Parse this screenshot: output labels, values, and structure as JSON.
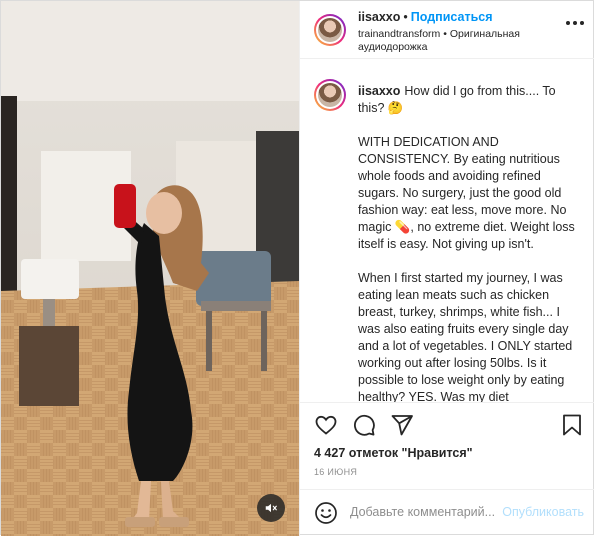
{
  "header": {
    "username": "iisaxxo",
    "separator": "•",
    "follow_label": "Подписаться",
    "audio_source": "trainandtransform",
    "audio_separator": "•",
    "audio_label": "Оригинальная аудиодорожка"
  },
  "caption": {
    "username": "iisaxxo",
    "paragraphs": [
      "How did I go from this.... To this? 🤔",
      "WITH DEDICATION AND CONSISTENCY. By eating nutritious whole foods and avoiding refined sugars. No surgery, just the good old fashion way: eat less, move more. No magic 💊, no extreme diet. Weight loss itself is easy. Not giving up isn't.",
      "When I first started my journey, I was eating lean meats such as chicken breast, turkey, shrimps, white fish... I was also eating fruits every single day and a lot of vegetables. I ONLY started working out after losing 50lbs. Is it possible to lose weight only by eating healthy? YES. Was my diet complicated? NO. Because it shouldn't"
    ]
  },
  "actions": {
    "likes": "4 427 отметок \"Нравится\"",
    "date": "16 ИЮНЯ"
  },
  "comment": {
    "placeholder": "Добавьте комментарий...",
    "publish_label": "Опубликовать"
  },
  "colors": {
    "accent": "#0095f6",
    "publish_disabled": "#b2dffc",
    "muted_text": "#8e8e8e",
    "dress": "#141414",
    "phone_case": "#c8121b"
  },
  "icons": [
    "heart-icon",
    "comment-icon",
    "share-icon",
    "bookmark-icon",
    "more-options-icon",
    "mute-icon",
    "emoji-icon"
  ]
}
